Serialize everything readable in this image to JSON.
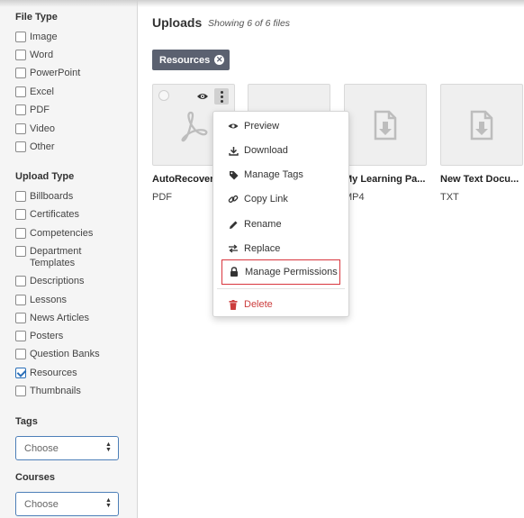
{
  "sidebar": {
    "file_type_title": "File Type",
    "file_types": [
      {
        "label": "Image",
        "checked": false
      },
      {
        "label": "Word",
        "checked": false
      },
      {
        "label": "PowerPoint",
        "checked": false
      },
      {
        "label": "Excel",
        "checked": false
      },
      {
        "label": "PDF",
        "checked": false
      },
      {
        "label": "Video",
        "checked": false
      },
      {
        "label": "Other",
        "checked": false
      }
    ],
    "upload_type_title": "Upload Type",
    "upload_types": [
      {
        "label": "Billboards",
        "checked": false
      },
      {
        "label": "Certificates",
        "checked": false
      },
      {
        "label": "Competencies",
        "checked": false
      },
      {
        "label": "Department Templates",
        "checked": false
      },
      {
        "label": "Descriptions",
        "checked": false
      },
      {
        "label": "Lessons",
        "checked": false
      },
      {
        "label": "News Articles",
        "checked": false
      },
      {
        "label": "Posters",
        "checked": false
      },
      {
        "label": "Question Banks",
        "checked": false
      },
      {
        "label": "Resources",
        "checked": true
      },
      {
        "label": "Thumbnails",
        "checked": false
      }
    ],
    "tags_title": "Tags",
    "tags_select": "Choose",
    "courses_title": "Courses",
    "courses_select": "Choose"
  },
  "main": {
    "title": "Uploads",
    "subtitle": "Showing 6 of 6 files",
    "filter_chip": "Resources",
    "files": [
      {
        "name": "AutoRecovery",
        "type": "PDF",
        "icon": "pdf-icon"
      },
      {
        "name": "",
        "type": "",
        "icon": "blank"
      },
      {
        "name": "My Learning Pa...",
        "type": "MP4",
        "icon": "file-download-icon"
      },
      {
        "name": "New Text Docu...",
        "type": "TXT",
        "icon": "file-download-icon"
      }
    ]
  },
  "menu": {
    "items": [
      {
        "label": "Preview",
        "icon": "eye-icon"
      },
      {
        "label": "Download",
        "icon": "download-icon"
      },
      {
        "label": "Manage Tags",
        "icon": "tag-icon"
      },
      {
        "label": "Copy Link",
        "icon": "link-icon"
      },
      {
        "label": "Rename",
        "icon": "pencil-icon"
      },
      {
        "label": "Replace",
        "icon": "swap-icon"
      },
      {
        "label": "Manage Permissions",
        "icon": "lock-icon"
      }
    ],
    "delete_label": "Delete",
    "delete_icon": "trash-icon",
    "highlight_color": "#d9363e",
    "delete_color": "#cc3d3d"
  },
  "colors": {
    "chip_bg": "#5b6170",
    "select_border": "#4d7fb8",
    "checkbox_checked": "#2a6fb8"
  }
}
